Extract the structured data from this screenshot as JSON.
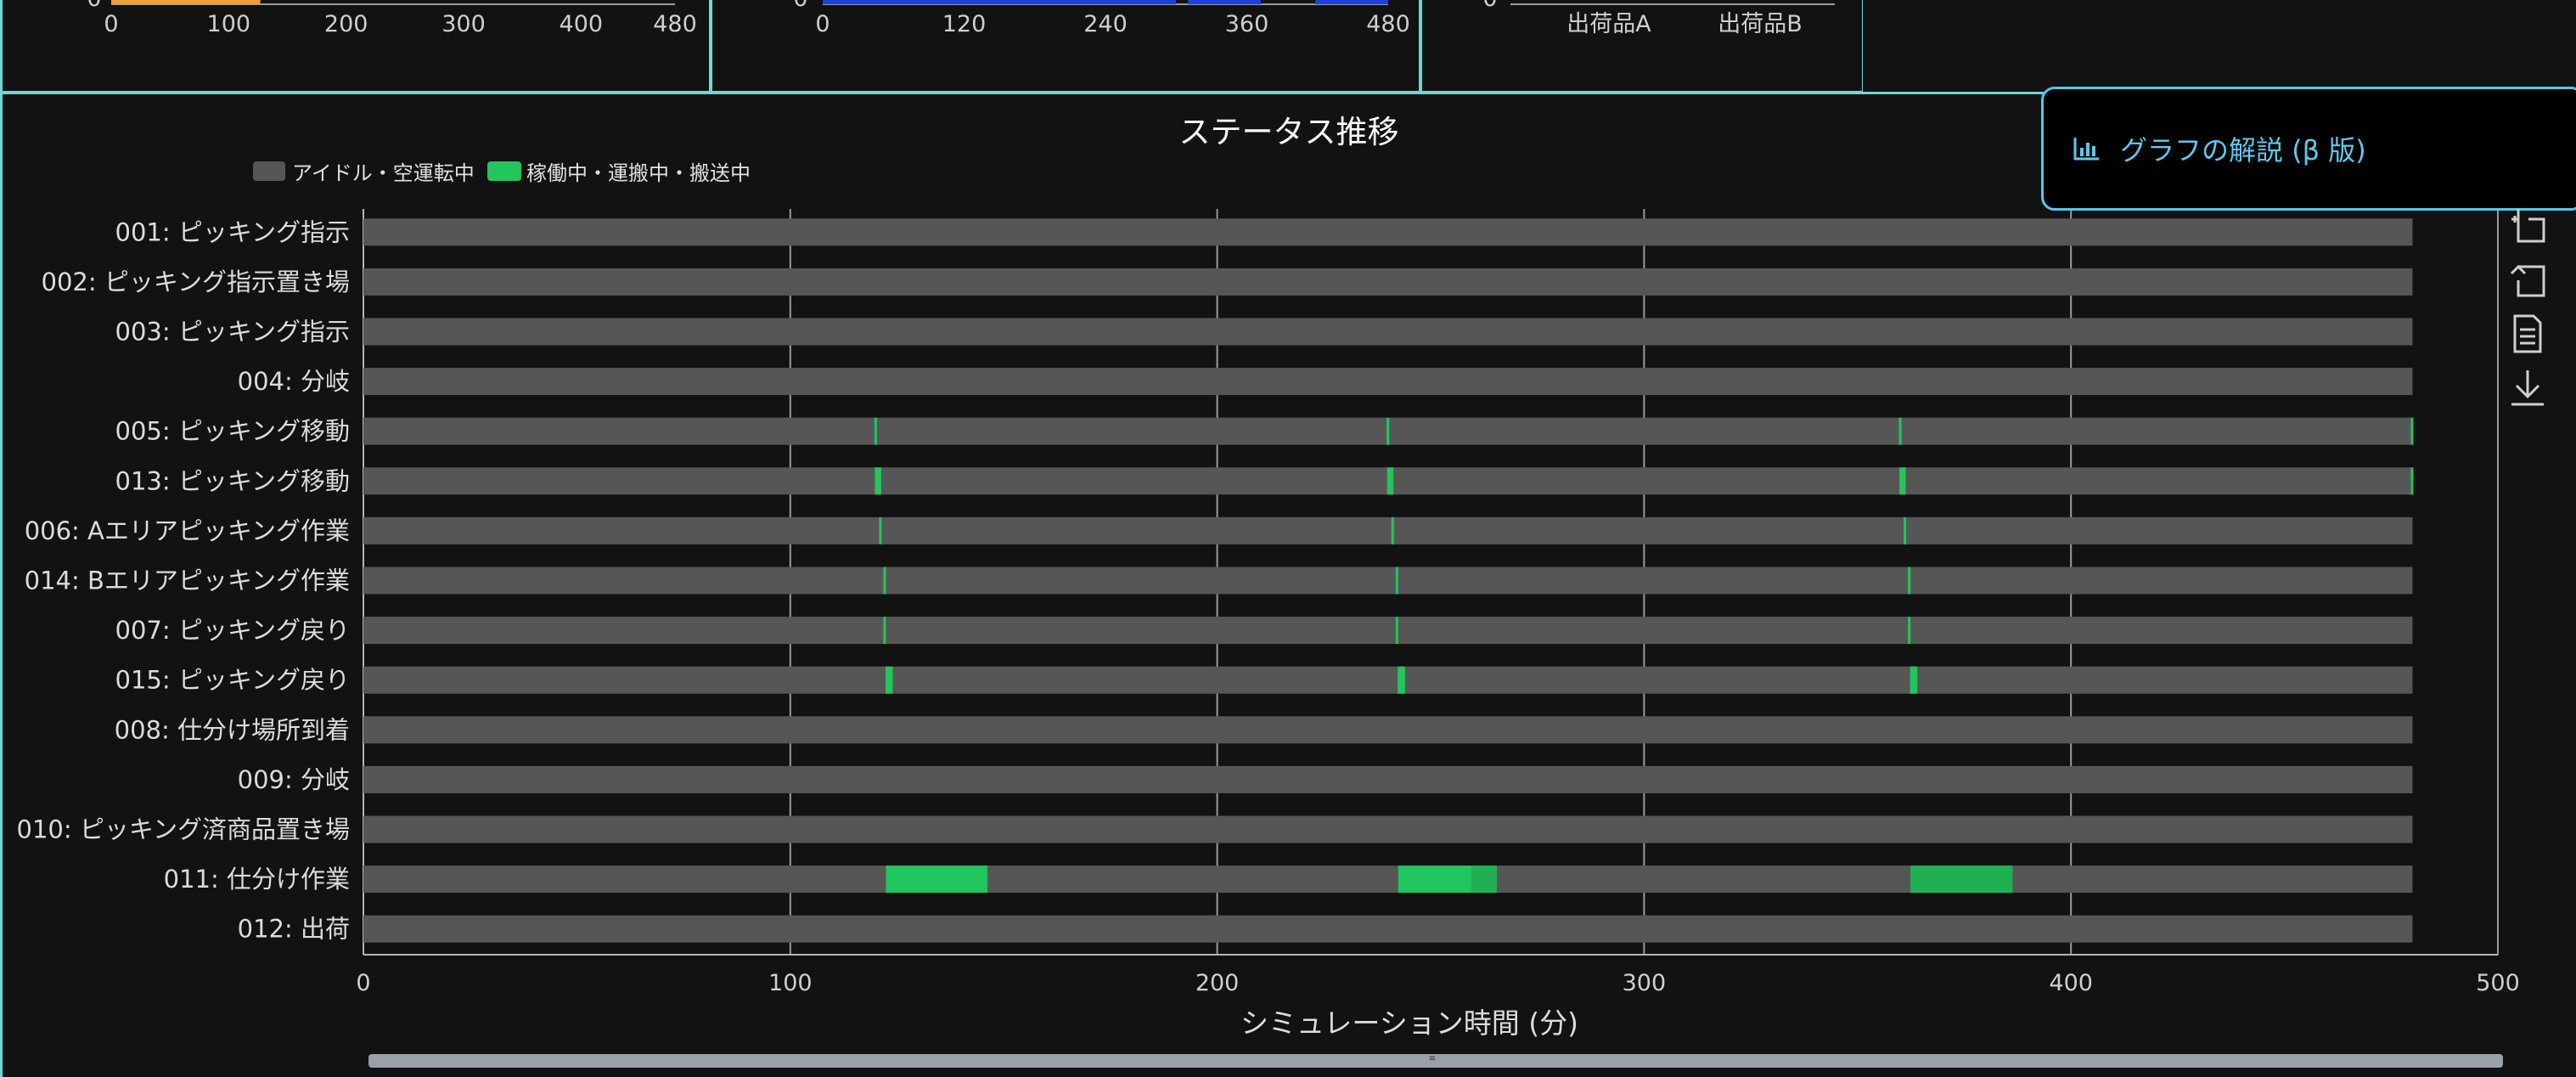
{
  "top_charts": [
    {
      "x_ticks": [
        "0",
        "100",
        "200",
        "300",
        "400",
        "480"
      ],
      "y_zero": "0",
      "bar_color": "#f0a030",
      "bar_value": 127
    },
    {
      "x_ticks": [
        "0",
        "120",
        "240",
        "360",
        "480"
      ],
      "y_zero": "0",
      "bar_color": "#1f3fe0"
    },
    {
      "categories": [
        "出荷品A",
        "出荷品B"
      ],
      "y_zero": "0"
    }
  ],
  "explain_button": {
    "label": "グラフの解説 (β 版)",
    "icon": "bar-chart-icon"
  },
  "toolbox": [
    "zoom-icon",
    "zoom-reset-icon",
    "data-view-icon",
    "download-icon"
  ],
  "colors": {
    "idle": "#565656",
    "active": "#22c55e",
    "active_dark": "#1f9e4a",
    "grid": "#9a9a9a"
  },
  "chart_data": {
    "type": "bar",
    "title": "ステータス推移",
    "xlabel": "シミュレーション時間 (分)",
    "ylabel": "",
    "xlim": [
      0,
      500
    ],
    "x_ticks": [
      0,
      100,
      200,
      300,
      400,
      500
    ],
    "legend": {
      "placement": "top-left",
      "items": [
        {
          "name": "アイドル・空運転中",
          "color": "#565656"
        },
        {
          "name": "稼働中・運搬中・搬送中",
          "color": "#22c55e"
        }
      ]
    },
    "idle_range": [
      0,
      480
    ],
    "categories": [
      "001: ピッキング指示",
      "002: ピッキング指示置き場",
      "003: ピッキング指示",
      "004: 分岐",
      "005: ピッキング移動",
      "013: ピッキング移動",
      "006: Aエリアピッキング作業",
      "014: Bエリアピッキング作業",
      "007: ピッキング戻り",
      "015: ピッキング戻り",
      "008: 仕分け場所到着",
      "009: 分岐",
      "010: ピッキング済商品置き場",
      "011: 仕分け作業",
      "012: 出荷"
    ],
    "active_segments": [
      [],
      [],
      [],
      [],
      [
        [
          119.7,
          120.3
        ],
        [
          239.7,
          240.3
        ],
        [
          359.7,
          360.3
        ],
        [
          479.6,
          480
        ]
      ],
      [
        [
          119.8,
          121.3
        ],
        [
          239.8,
          241.3
        ],
        [
          359.8,
          361.3
        ],
        [
          479.6,
          480
        ]
      ],
      [
        [
          120.8,
          121.4
        ],
        [
          240.8,
          241.4
        ],
        [
          360.8,
          361.4
        ]
      ],
      [
        [
          121.8,
          122.4
        ],
        [
          241.8,
          242.4
        ],
        [
          361.8,
          362.4
        ]
      ],
      [
        [
          121.8,
          122.4
        ],
        [
          241.8,
          242.4
        ],
        [
          361.8,
          362.4
        ]
      ],
      [
        [
          122.3,
          124.0
        ],
        [
          242.3,
          244.0
        ],
        [
          362.3,
          364.0
        ]
      ],
      [],
      [],
      [],
      [
        [
          122.4,
          146.2
        ],
        [
          242.4,
          265.5
        ],
        [
          362.4,
          386.3
        ]
      ],
      []
    ],
    "active_segments_dark": [
      [],
      [],
      [],
      [],
      [],
      [],
      [],
      [],
      [],
      [],
      [],
      [],
      [],
      [
        [
          259.5,
          265.5
        ],
        [
          362.4,
          386.3
        ]
      ],
      []
    ]
  }
}
